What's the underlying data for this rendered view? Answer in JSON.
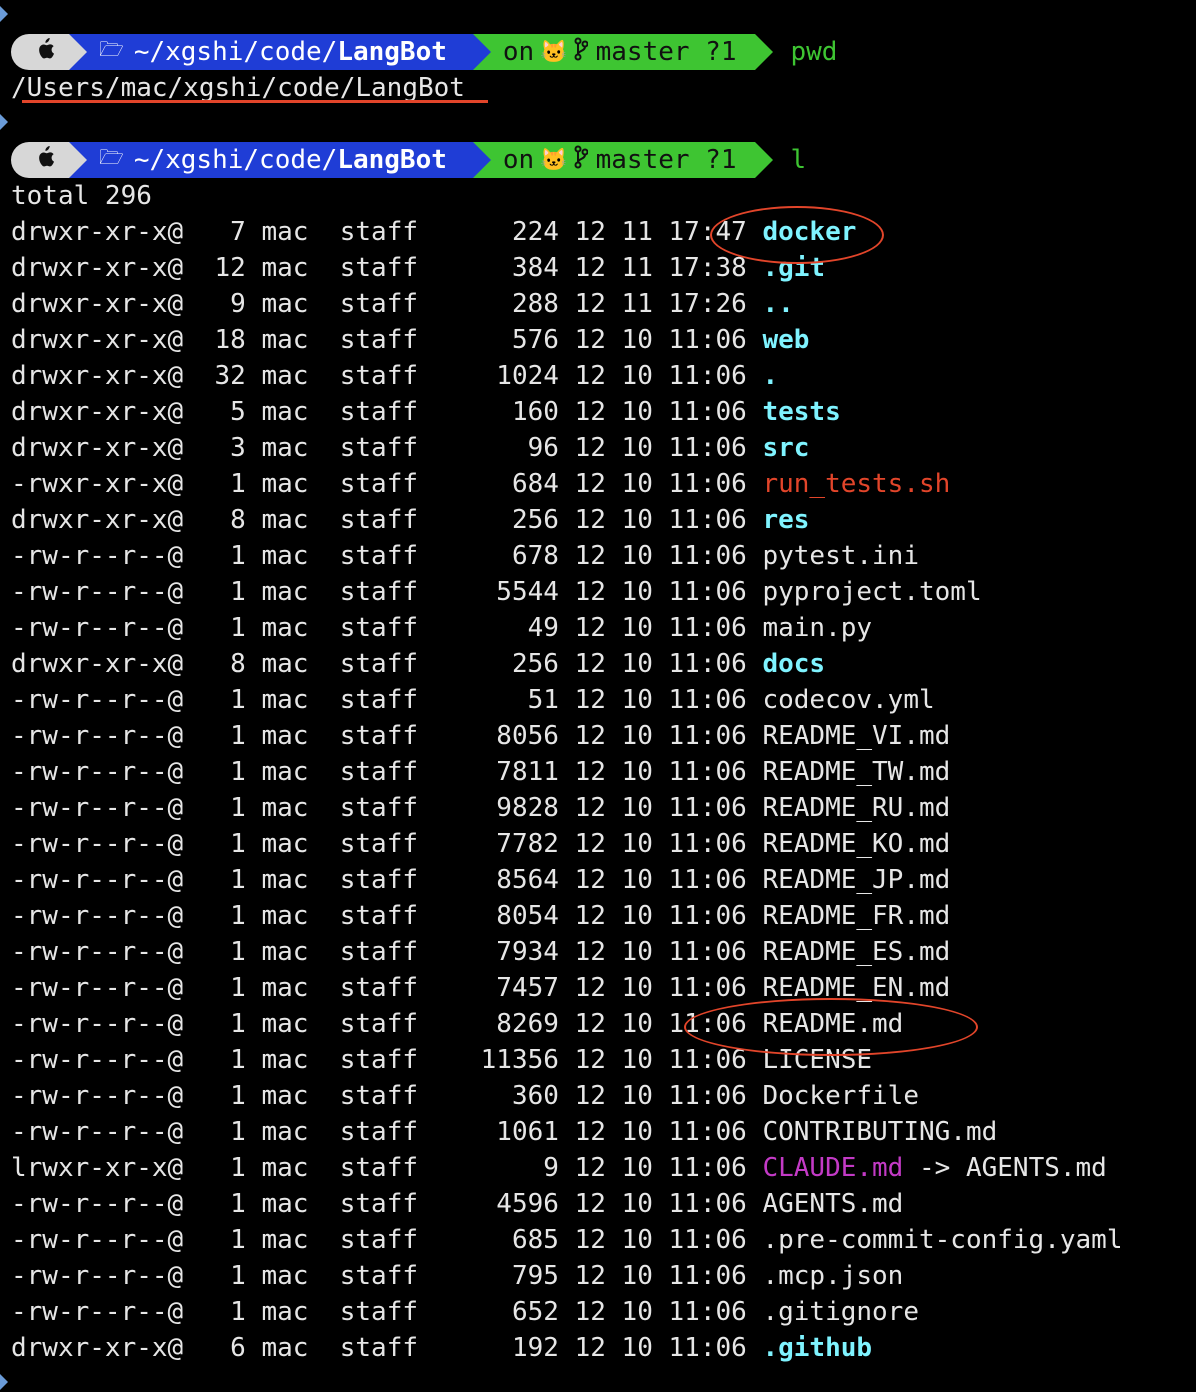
{
  "prompt": {
    "apple_icon": "apple-icon",
    "folder_icon": "folder-icon",
    "dir_prefix": "~/xgshi/code/",
    "dir_name": "LangBot",
    "git_on": "on",
    "git_icon": "github-icon",
    "branch_icon": "branch-icon",
    "branch": "master ?1"
  },
  "commands": [
    "pwd",
    "l"
  ],
  "pwd_output": "/Users/mac/xgshi/code/LangBot",
  "total": "total 296",
  "colors": {
    "prompt_apple_bg": "#d7d7d7",
    "prompt_dir_bg": "#1f3dd6",
    "prompt_git_bg": "#3ec532",
    "dir": "#7ff3ff",
    "exec": "#e2452a",
    "link": "#c33ac6",
    "annotation": "#e2452a"
  },
  "listing": [
    {
      "perm": "drwxr-xr-x@",
      "links": "7",
      "owner": "mac",
      "group": "staff",
      "size": "224",
      "mon": "12",
      "day": "11",
      "time": "17:47",
      "name": "docker",
      "kind": "dir"
    },
    {
      "perm": "drwxr-xr-x@",
      "links": "12",
      "owner": "mac",
      "group": "staff",
      "size": "384",
      "mon": "12",
      "day": "11",
      "time": "17:38",
      "name": ".git",
      "kind": "dir"
    },
    {
      "perm": "drwxr-xr-x@",
      "links": "9",
      "owner": "mac",
      "group": "staff",
      "size": "288",
      "mon": "12",
      "day": "11",
      "time": "17:26",
      "name": "..",
      "kind": "dir"
    },
    {
      "perm": "drwxr-xr-x@",
      "links": "18",
      "owner": "mac",
      "group": "staff",
      "size": "576",
      "mon": "12",
      "day": "10",
      "time": "11:06",
      "name": "web",
      "kind": "dir"
    },
    {
      "perm": "drwxr-xr-x@",
      "links": "32",
      "owner": "mac",
      "group": "staff",
      "size": "1024",
      "mon": "12",
      "day": "10",
      "time": "11:06",
      "name": ".",
      "kind": "dir"
    },
    {
      "perm": "drwxr-xr-x@",
      "links": "5",
      "owner": "mac",
      "group": "staff",
      "size": "160",
      "mon": "12",
      "day": "10",
      "time": "11:06",
      "name": "tests",
      "kind": "dir"
    },
    {
      "perm": "drwxr-xr-x@",
      "links": "3",
      "owner": "mac",
      "group": "staff",
      "size": "96",
      "mon": "12",
      "day": "10",
      "time": "11:06",
      "name": "src",
      "kind": "dir"
    },
    {
      "perm": "-rwxr-xr-x@",
      "links": "1",
      "owner": "mac",
      "group": "staff",
      "size": "684",
      "mon": "12",
      "day": "10",
      "time": "11:06",
      "name": "run_tests.sh",
      "kind": "exe"
    },
    {
      "perm": "drwxr-xr-x@",
      "links": "8",
      "owner": "mac",
      "group": "staff",
      "size": "256",
      "mon": "12",
      "day": "10",
      "time": "11:06",
      "name": "res",
      "kind": "dir"
    },
    {
      "perm": "-rw-r--r--@",
      "links": "1",
      "owner": "mac",
      "group": "staff",
      "size": "678",
      "mon": "12",
      "day": "10",
      "time": "11:06",
      "name": "pytest.ini",
      "kind": "file"
    },
    {
      "perm": "-rw-r--r--@",
      "links": "1",
      "owner": "mac",
      "group": "staff",
      "size": "5544",
      "mon": "12",
      "day": "10",
      "time": "11:06",
      "name": "pyproject.toml",
      "kind": "file"
    },
    {
      "perm": "-rw-r--r--@",
      "links": "1",
      "owner": "mac",
      "group": "staff",
      "size": "49",
      "mon": "12",
      "day": "10",
      "time": "11:06",
      "name": "main.py",
      "kind": "file"
    },
    {
      "perm": "drwxr-xr-x@",
      "links": "8",
      "owner": "mac",
      "group": "staff",
      "size": "256",
      "mon": "12",
      "day": "10",
      "time": "11:06",
      "name": "docs",
      "kind": "dir"
    },
    {
      "perm": "-rw-r--r--@",
      "links": "1",
      "owner": "mac",
      "group": "staff",
      "size": "51",
      "mon": "12",
      "day": "10",
      "time": "11:06",
      "name": "codecov.yml",
      "kind": "file"
    },
    {
      "perm": "-rw-r--r--@",
      "links": "1",
      "owner": "mac",
      "group": "staff",
      "size": "8056",
      "mon": "12",
      "day": "10",
      "time": "11:06",
      "name": "README_VI.md",
      "kind": "file"
    },
    {
      "perm": "-rw-r--r--@",
      "links": "1",
      "owner": "mac",
      "group": "staff",
      "size": "7811",
      "mon": "12",
      "day": "10",
      "time": "11:06",
      "name": "README_TW.md",
      "kind": "file"
    },
    {
      "perm": "-rw-r--r--@",
      "links": "1",
      "owner": "mac",
      "group": "staff",
      "size": "9828",
      "mon": "12",
      "day": "10",
      "time": "11:06",
      "name": "README_RU.md",
      "kind": "file"
    },
    {
      "perm": "-rw-r--r--@",
      "links": "1",
      "owner": "mac",
      "group": "staff",
      "size": "7782",
      "mon": "12",
      "day": "10",
      "time": "11:06",
      "name": "README_KO.md",
      "kind": "file"
    },
    {
      "perm": "-rw-r--r--@",
      "links": "1",
      "owner": "mac",
      "group": "staff",
      "size": "8564",
      "mon": "12",
      "day": "10",
      "time": "11:06",
      "name": "README_JP.md",
      "kind": "file"
    },
    {
      "perm": "-rw-r--r--@",
      "links": "1",
      "owner": "mac",
      "group": "staff",
      "size": "8054",
      "mon": "12",
      "day": "10",
      "time": "11:06",
      "name": "README_FR.md",
      "kind": "file"
    },
    {
      "perm": "-rw-r--r--@",
      "links": "1",
      "owner": "mac",
      "group": "staff",
      "size": "7934",
      "mon": "12",
      "day": "10",
      "time": "11:06",
      "name": "README_ES.md",
      "kind": "file"
    },
    {
      "perm": "-rw-r--r--@",
      "links": "1",
      "owner": "mac",
      "group": "staff",
      "size": "7457",
      "mon": "12",
      "day": "10",
      "time": "11:06",
      "name": "README_EN.md",
      "kind": "file"
    },
    {
      "perm": "-rw-r--r--@",
      "links": "1",
      "owner": "mac",
      "group": "staff",
      "size": "8269",
      "mon": "12",
      "day": "10",
      "time": "11:06",
      "name": "README.md",
      "kind": "file"
    },
    {
      "perm": "-rw-r--r--@",
      "links": "1",
      "owner": "mac",
      "group": "staff",
      "size": "11356",
      "mon": "12",
      "day": "10",
      "time": "11:06",
      "name": "LICENSE",
      "kind": "file"
    },
    {
      "perm": "-rw-r--r--@",
      "links": "1",
      "owner": "mac",
      "group": "staff",
      "size": "360",
      "mon": "12",
      "day": "10",
      "time": "11:06",
      "name": "Dockerfile",
      "kind": "file"
    },
    {
      "perm": "-rw-r--r--@",
      "links": "1",
      "owner": "mac",
      "group": "staff",
      "size": "1061",
      "mon": "12",
      "day": "10",
      "time": "11:06",
      "name": "CONTRIBUTING.md",
      "kind": "file"
    },
    {
      "perm": "lrwxr-xr-x@",
      "links": "1",
      "owner": "mac",
      "group": "staff",
      "size": "9",
      "mon": "12",
      "day": "10",
      "time": "11:06",
      "name": "CLAUDE.md",
      "kind": "link",
      "target": " -> AGENTS.md"
    },
    {
      "perm": "-rw-r--r--@",
      "links": "1",
      "owner": "mac",
      "group": "staff",
      "size": "4596",
      "mon": "12",
      "day": "10",
      "time": "11:06",
      "name": "AGENTS.md",
      "kind": "file"
    },
    {
      "perm": "-rw-r--r--@",
      "links": "1",
      "owner": "mac",
      "group": "staff",
      "size": "685",
      "mon": "12",
      "day": "10",
      "time": "11:06",
      "name": ".pre-commit-config.yaml",
      "kind": "file"
    },
    {
      "perm": "-rw-r--r--@",
      "links": "1",
      "owner": "mac",
      "group": "staff",
      "size": "795",
      "mon": "12",
      "day": "10",
      "time": "11:06",
      "name": ".mcp.json",
      "kind": "file"
    },
    {
      "perm": "-rw-r--r--@",
      "links": "1",
      "owner": "mac",
      "group": "staff",
      "size": "652",
      "mon": "12",
      "day": "10",
      "time": "11:06",
      "name": ".gitignore",
      "kind": "file"
    },
    {
      "perm": "drwxr-xr-x@",
      "links": "6",
      "owner": "mac",
      "group": "staff",
      "size": "192",
      "mon": "12",
      "day": "10",
      "time": "11:06",
      "name": ".github",
      "kind": "dir"
    }
  ]
}
